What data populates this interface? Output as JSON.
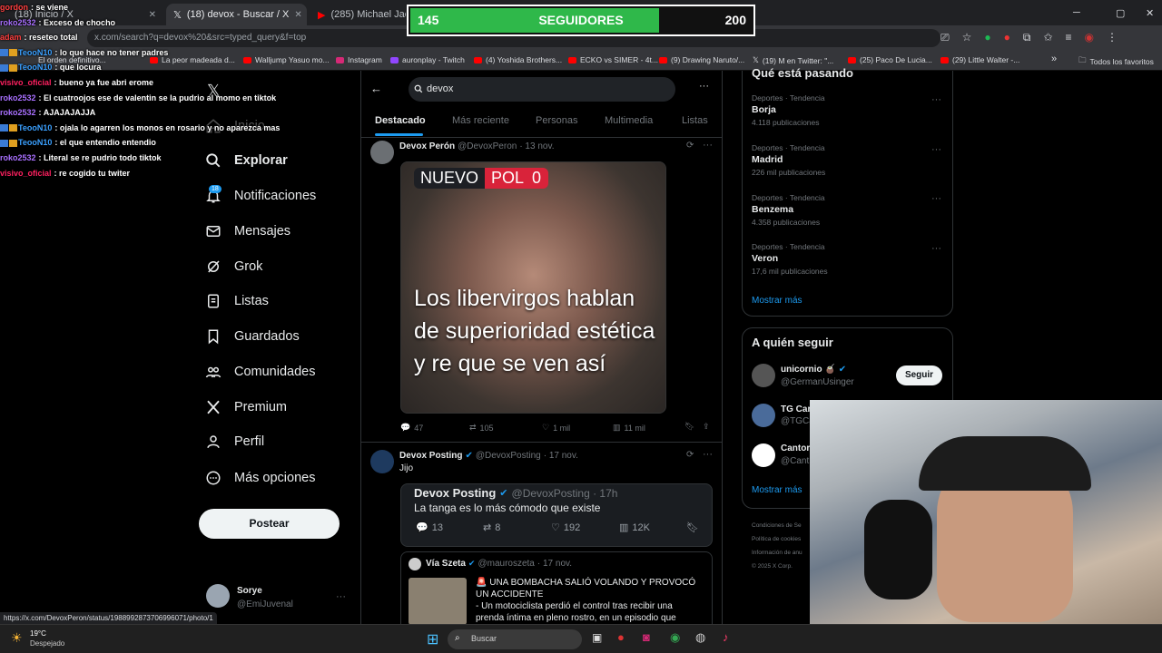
{
  "browser": {
    "tabs": [
      {
        "label": "(18) Inicio / X"
      },
      {
        "label": "(18) devox - Buscar / X"
      },
      {
        "label": "(285) Michael Jackson -"
      }
    ],
    "url": "x.com/search?q=devox%20&src=typed_query&f=top",
    "bookmarks": [
      "El orden definitivo...",
      "La peor madeada d...",
      "Walljump Yasuo mo...",
      "Instagram",
      "auronplay - Twitch",
      "(4) Yoshida Brothers...",
      "ECKO vs SIMER - 4t...",
      "(9) Drawing Naruto/...",
      "(19) M en Twitter: \"...",
      "(25) Paco De Lucia...",
      "(29) Little Walter -..."
    ],
    "all_bookmarks": "Todos los favoritos",
    "status_url": "https://x.com/DevoxPeron/status/1988992873706996071/photo/1"
  },
  "overlay": {
    "current": "145",
    "label": "SEGUIDORES",
    "goal": "200",
    "progress": 0.725,
    "chat": [
      {
        "user": "gordon",
        "msg": "se viene",
        "color": "#ff4040",
        "badge": false
      },
      {
        "user": "roko2532",
        "msg": "Exceso de chocho",
        "color": "#a970ff",
        "badge": false
      },
      {
        "user": "adam",
        "msg": "reseteo total",
        "color": "#ff4040",
        "badge": false
      },
      {
        "user": "TeooN10",
        "msg": "lo que hace no tener padres",
        "color": "#3aa0ff",
        "badge": true
      },
      {
        "user": "TeooN10",
        "msg": "que locura",
        "color": "#3aa0ff",
        "badge": true
      },
      {
        "user": "visivo_oficial",
        "msg": "bueno ya fue abri erome",
        "color": "#ff2060",
        "badge": false
      },
      {
        "user": "roko2532",
        "msg": "El cuatroojos ese de valentin se la pudrio al momo en tiktok",
        "color": "#a970ff",
        "badge": false
      },
      {
        "user": "roko2532",
        "msg": "AJAJAJAJJA",
        "color": "#a970ff",
        "badge": false
      },
      {
        "user": "TeooN10",
        "msg": "ojala lo agarren los monos en rosario y no aparezca mas",
        "color": "#3aa0ff",
        "badge": true
      },
      {
        "user": "TeooN10",
        "msg": "el que entendio entendio",
        "color": "#3aa0ff",
        "badge": true
      },
      {
        "user": "roko2532",
        "msg": "Literal se re pudrio todo tiktok",
        "color": "#a970ff",
        "badge": false
      },
      {
        "user": "visivo_oficial",
        "msg": "re cogido tu twiter",
        "color": "#ff2060",
        "badge": false
      }
    ]
  },
  "nav": {
    "items": [
      "Inicio",
      "Explorar",
      "Notificaciones",
      "Mensajes",
      "Grok",
      "Listas",
      "Guardados",
      "Comunidades",
      "Premium",
      "Perfil",
      "Más opciones"
    ],
    "notif_count": "18",
    "post_button": "Postear",
    "account_name": "Sorye",
    "account_handle": "@EmiJuvenal"
  },
  "search": {
    "query": "devox",
    "tabs": [
      "Destacado",
      "Más reciente",
      "Personas",
      "Multimedia",
      "Listas"
    ]
  },
  "posts": {
    "p1": {
      "name": "Devox Perón",
      "handle": "@DevoxPeron",
      "date": "· 13 nov.",
      "overlay_badge1": "NUEVO",
      "overlay_badge2": "POL",
      "overlay_badge3": "0",
      "image_text": "Los libervirgos hablan de superioridad estética y re que se ven así",
      "replies": "47",
      "reposts": "105",
      "likes": "1 mil",
      "views": "11 mil"
    },
    "p2": {
      "name": "Devox Posting",
      "handle": "@DevoxPosting",
      "date": "· 17 nov.",
      "text": "Jijo",
      "q_name": "Devox Posting",
      "q_handle": "@DevoxPosting · 17h",
      "q_text": "La tanga es lo más cómodo que existe",
      "q_replies": "13",
      "q_reposts": "8",
      "q_likes": "192",
      "q_views": "12K"
    },
    "p3": {
      "name": "Vía Szeta",
      "handle": "@mauroszeta",
      "date": "· 17 nov.",
      "line1": "🚨 UNA BOMBACHA SALIÓ VOLANDO Y PROVOCÓ UN ACCIDENTE",
      "line2": "- Un motociclista perdió el control tras recibir una prenda íntima en pleno rostro, en un episodio que"
    }
  },
  "trends": {
    "title": "Qué está pasando",
    "items": [
      {
        "cat": "Deportes · Tendencia",
        "name": "Borja",
        "count": "4.118 publicaciones"
      },
      {
        "cat": "Deportes · Tendencia",
        "name": "Madrid",
        "count": "226 mil publicaciones"
      },
      {
        "cat": "Deportes · Tendencia",
        "name": "Benzema",
        "count": "4.358 publicaciones"
      },
      {
        "cat": "Deportes · Tendencia",
        "name": "Veron",
        "count": "17,6 mil publicaciones"
      }
    ],
    "show_more": "Mostrar más"
  },
  "who": {
    "title": "A quién seguir",
    "items": [
      {
        "name": "unicornio 🧉",
        "handle": "@GermanUsinger"
      },
      {
        "name": "TG Car",
        "handle": "@TGCa"
      },
      {
        "name": "Cantor",
        "handle": "@Cant"
      }
    ],
    "follow_btn": "Seguir",
    "show_more": "Mostrar más"
  },
  "footer_links": [
    "Condiciones de Se",
    "Política de cookies",
    "Información de anu",
    "© 2025 X Corp."
  ],
  "taskbar": {
    "temp": "19°C",
    "weather": "Despejado",
    "search": "Buscar"
  }
}
